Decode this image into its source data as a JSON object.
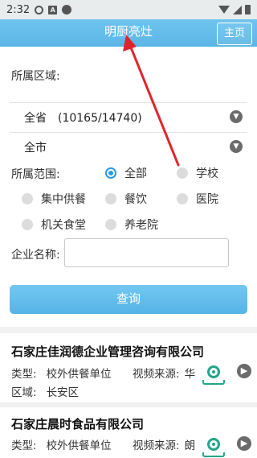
{
  "status_bar": {
    "time": "2:32",
    "a_badge": "A"
  },
  "header": {
    "title": "明厨亮灶",
    "home_label": "主页"
  },
  "filters": {
    "region_label": "所属区域:",
    "province_value": "全省　(10165/14740)",
    "city_value": "全市",
    "scope_label": "所属范围:",
    "scope_options": [
      "全部",
      "学校",
      "集中供餐",
      "餐饮",
      "医院",
      "机关食堂",
      "养老院"
    ],
    "scope_selected": "全部",
    "company_label": "企业名称:",
    "company_value": "",
    "query_label": "查询"
  },
  "results": [
    {
      "name": "石家庄佳润德企业管理咨询有限公司",
      "type_label": "类型:",
      "type_value": "校外供餐单位",
      "source_label": "视频来源:",
      "source_value": "华",
      "area_label": "区域:",
      "area_value": "长安区"
    },
    {
      "name": "石家庄晨时食品有限公司",
      "type_label": "类型:",
      "type_value": "校外供餐单位",
      "source_label": "视频来源:",
      "source_value": "朗"
    }
  ],
  "icons": {
    "settings": "gear-icon",
    "notification": "a-icon",
    "dot": "circle-icon",
    "wifi": "wifi-icon",
    "signal": "signal-icon",
    "battery": "battery-icon",
    "chevron": "chevron-down-icon",
    "camera": "camera-icon",
    "arrow": "chevron-right-icon"
  },
  "colors": {
    "accent": "#5cb6e6",
    "camera": "#23a58a",
    "annotation": "#e0242b"
  }
}
